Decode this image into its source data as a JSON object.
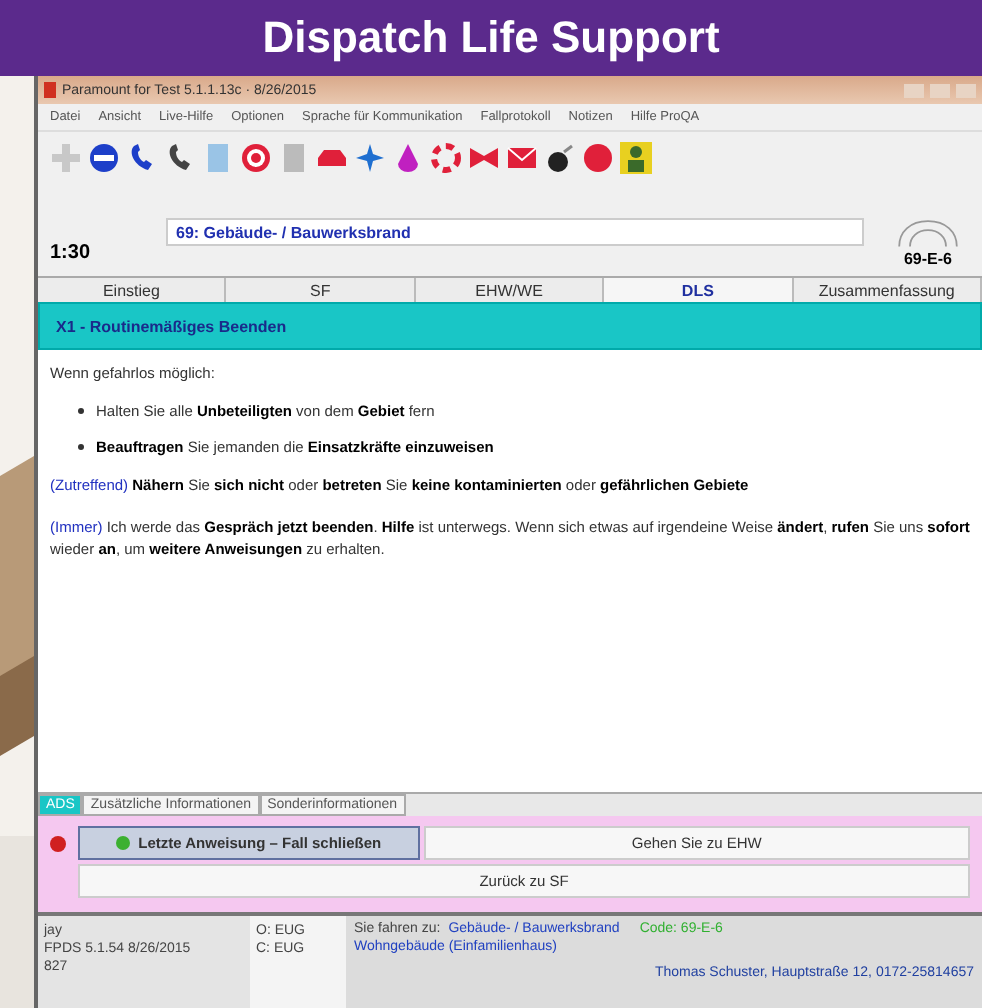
{
  "banner": {
    "title": "Dispatch Life Support"
  },
  "window": {
    "title": "Paramount for Test 5.1.1.13c · 8/26/2015"
  },
  "menu": [
    "Datei",
    "Ansicht",
    "Live-Hilfe",
    "Optionen",
    "Sprache für Kommunikation",
    "Fallprotokoll",
    "Notizen",
    "Hilfe ProQA"
  ],
  "determinant": {
    "time": "1:30",
    "chief_complaint": "69:  Gebäude- / Bauwerksbrand",
    "code": "69-E-6"
  },
  "tabs": [
    {
      "label": "Einstieg",
      "selected": false
    },
    {
      "label": "SF",
      "selected": false
    },
    {
      "label": "EHW/WE",
      "selected": false
    },
    {
      "label": "DLS",
      "selected": true
    },
    {
      "label": "Zusammenfassung",
      "selected": false
    }
  ],
  "section": {
    "title": "X1 - Routinemäßiges Beenden"
  },
  "content": [
    {
      "kind": "para",
      "text": "Wenn gefahrlos möglich:"
    },
    {
      "kind": "bullet",
      "text": "Halten Sie alle **Unbeteiligten** von dem **Gebiet** fern"
    },
    {
      "kind": "bullet",
      "text": "**Beauftragen** Sie jemanden die **Einsatzkräfte einzuweisen**"
    },
    {
      "kind": "para",
      "tag": "(Zutreffend)",
      "text": " **Nähern** Sie **sich nicht** oder **betreten** Sie **keine kontaminierten** oder **gefährlichen Gebiete**"
    },
    {
      "kind": "para",
      "tag": "(Immer)",
      "text": " Ich werde das **Gespräch jetzt beenden**.  **Hilfe** ist unterwegs.  Wenn sich etwas auf irgendeine Weise **ändert**, **rufen** Sie uns **sofort** wieder **an**, um **weitere Anweisungen** zu erhalten."
    }
  ],
  "bottom_tabs": [
    {
      "label": "ADS",
      "selected": true
    },
    {
      "label": "Zusätzliche Informationen",
      "selected": false
    },
    {
      "label": "Sonderinformationen",
      "selected": false
    }
  ],
  "actions": [
    {
      "label": "Letzte Anweisung – Fall schließen",
      "selected": true
    },
    {
      "label": "Gehen Sie zu EHW",
      "selected": false
    },
    {
      "label": "Zurück zu SF",
      "selected": false
    }
  ],
  "status": {
    "user": [
      "jay",
      "FPDS 5.1.54 8/26/2015",
      "827"
    ],
    "centers": [
      "O: EUG",
      "C: EUG"
    ],
    "route_label": "Sie fahren zu:",
    "route_complaint": "Gebäude- / Bauwerksbrand",
    "route_code": "Code: 69-E-6",
    "route_detail": "Wohngebäude (Einfamilienhaus)",
    "caller": "Thomas Schuster, Hauptstraße 12, 0172-25814657"
  }
}
